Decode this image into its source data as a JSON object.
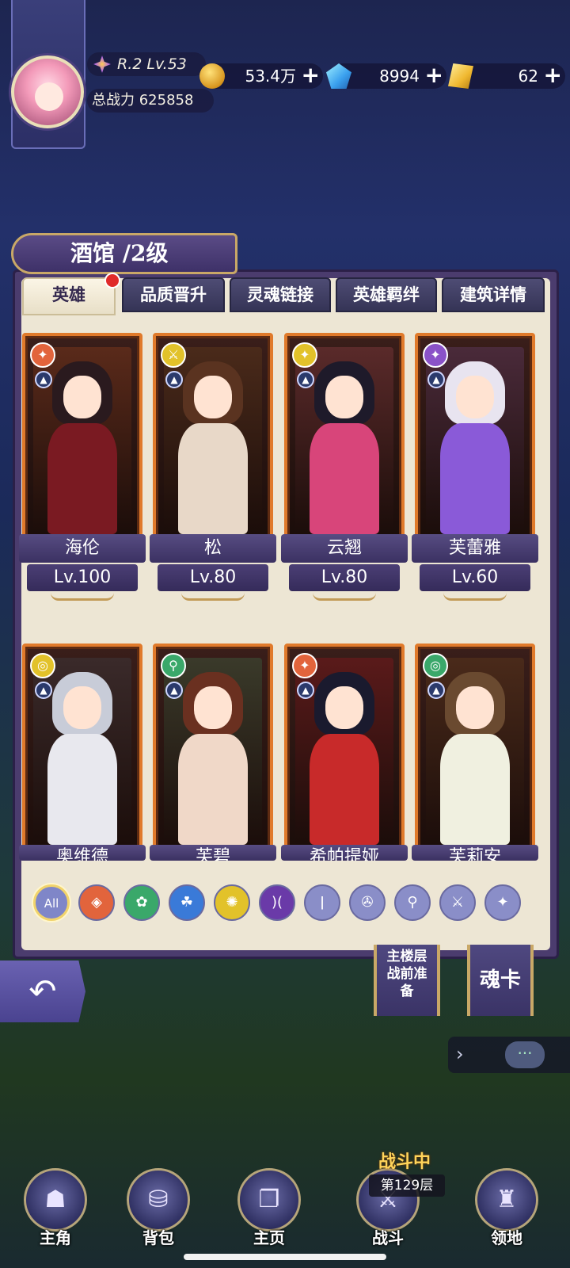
{
  "player": {
    "level_text": "R.2 Lv.53",
    "power_label": "总战力",
    "power_value": "625858"
  },
  "resources": [
    {
      "icon": "gold-coin-icon",
      "value": "53.4万",
      "plus": "+"
    },
    {
      "icon": "diamond-icon",
      "value": "8994",
      "plus": "+"
    },
    {
      "icon": "ticket-icon",
      "value": "62",
      "plus": "+"
    }
  ],
  "panel": {
    "title": "酒馆 /2级",
    "tabs": [
      "英雄",
      "品质晋升",
      "灵魂链接",
      "英雄羁绊",
      "建筑详情"
    ]
  },
  "heroes": [
    {
      "name": "海伦",
      "level": "Lv.100",
      "badge": "✦",
      "badge_color": "#e2643c",
      "hair": "#2a1a1e",
      "body": "#7a1a22",
      "bg": "#5a2a1a"
    },
    {
      "name": "松",
      "level": "Lv.80",
      "badge": "⚔",
      "badge_color": "#e2c22a",
      "hair": "#5a3320",
      "body": "#e8d8c8",
      "bg": "#4a2a1a"
    },
    {
      "name": "云翘",
      "level": "Lv.80",
      "badge": "✦",
      "badge_color": "#e2c22a",
      "hair": "#1e1a2a",
      "body": "#d8457a",
      "bg": "#5a2a2a"
    },
    {
      "name": "芙蕾雅",
      "level": "Lv.60",
      "badge": "✦",
      "badge_color": "#8a52c8",
      "hair": "#e8e4f0",
      "body": "#8a5ad8",
      "bg": "#4a2a3a"
    },
    {
      "name": "奥维德",
      "level": "",
      "badge": "◎",
      "badge_color": "#e2c22a",
      "hair": "#c8ccd8",
      "body": "#e8e8ee",
      "bg": "#3a2a2a"
    },
    {
      "name": "芙碧",
      "level": "",
      "badge": "⚲",
      "badge_color": "#3aa86a",
      "hair": "#6a3020",
      "body": "#f0d8c8",
      "bg": "#3a3a2a"
    },
    {
      "name": "希帕提娅",
      "level": "",
      "badge": "✦",
      "badge_color": "#e2643c",
      "hair": "#1a1a2e",
      "body": "#c82a2a",
      "bg": "#5a1a1a"
    },
    {
      "name": "芙莉安",
      "level": "",
      "badge": "◎",
      "badge_color": "#3aa86a",
      "hair": "#6a4a30",
      "body": "#f0f0e0",
      "bg": "#4a2a1a"
    }
  ],
  "filters": [
    {
      "label": "All",
      "icon": "all-filter",
      "color": "#7f86c8"
    },
    {
      "label": "",
      "icon": "fire-element-icon",
      "color": "#e2643c",
      "glyph": "◈"
    },
    {
      "label": "",
      "icon": "wind-element-icon",
      "color": "#3aa86a",
      "glyph": "✿"
    },
    {
      "label": "",
      "icon": "water-element-icon",
      "color": "#3a7ad8",
      "glyph": "☘"
    },
    {
      "label": "",
      "icon": "light-element-icon",
      "color": "#e2c22a",
      "glyph": "✺"
    },
    {
      "label": "",
      "icon": "dark-element-icon",
      "color": "#6a3aa8",
      "glyph": ")("
    },
    {
      "label": "",
      "icon": "sword-class-icon",
      "color": "#8a8ec8",
      "glyph": "ǀ"
    },
    {
      "label": "",
      "icon": "spin-class-icon",
      "color": "#8a8ec8",
      "glyph": "✇"
    },
    {
      "label": "",
      "icon": "staff-class-icon",
      "color": "#8a8ec8",
      "glyph": "⚲"
    },
    {
      "label": "",
      "icon": "bow-class-icon",
      "color": "#8a8ec8",
      "glyph": "⚔"
    },
    {
      "label": "",
      "icon": "wing-class-icon",
      "color": "#8a8ec8",
      "glyph": "✦"
    }
  ],
  "side_buttons": {
    "prebattle": "主楼层战前准备",
    "soul_card": "魂卡"
  },
  "battle_status": {
    "tag": "战斗中",
    "floor": "第129层"
  },
  "nav": [
    {
      "label": "主角",
      "icon": "hooded-hero-icon",
      "glyph": "☗"
    },
    {
      "label": "背包",
      "icon": "bag-icon",
      "glyph": "⛁"
    },
    {
      "label": "主页",
      "icon": "book-icon",
      "glyph": "❐"
    },
    {
      "label": "战斗",
      "icon": "crossed-swords-icon",
      "glyph": "⚔"
    },
    {
      "label": "领地",
      "icon": "castle-icon",
      "glyph": "♜"
    }
  ]
}
